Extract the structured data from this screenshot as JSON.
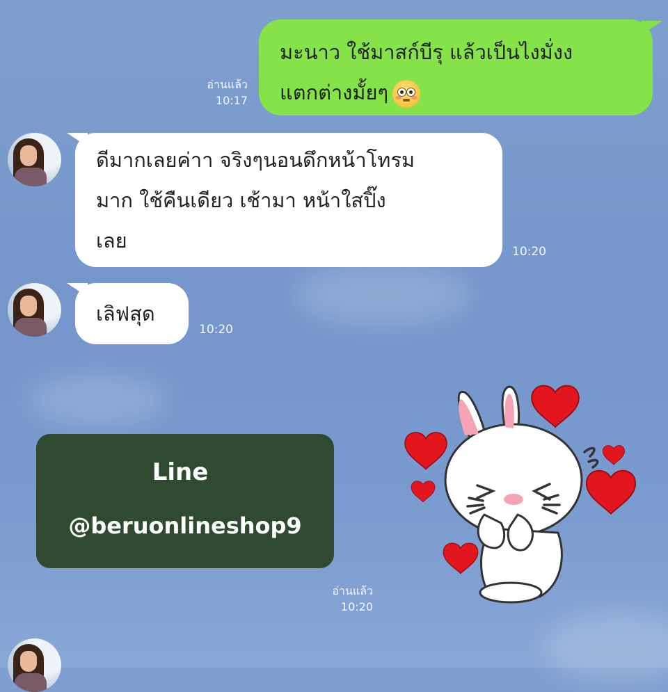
{
  "chat": {
    "messages": [
      {
        "direction": "outgoing",
        "lines": [
          "มะนาว ใช้มาสก์บีรุ แล้วเป็นไงมั่งง",
          "แตกต่างมั้ยๆ"
        ],
        "emoji": "flushed-face-emoji",
        "read_label": "อ่านแล้ว",
        "time": "10:17"
      },
      {
        "direction": "incoming",
        "lines": [
          "ดีมากเลยค่าา จริงๆนอนดึกหน้าโทรม",
          "มาก ใช้คืนเดียว เช้ามา หน้าใสปิ๊ง",
          "เลย"
        ],
        "time": "10:20"
      },
      {
        "direction": "incoming",
        "lines": [
          "เลิฟสุด"
        ],
        "time": "10:20"
      },
      {
        "direction": "outgoing",
        "type": "sticker",
        "sticker": "cony-rabbit-hearts-sticker",
        "read_label": "อ่านแล้ว",
        "time": "10:20"
      }
    ]
  },
  "promo": {
    "line1": "Line",
    "line2": "@beruonlineshop9",
    "background": "#2f4a30"
  },
  "colors": {
    "outgoing_bubble": "#85e249",
    "incoming_bubble": "#ffffff",
    "background": "#7a9bcf"
  }
}
